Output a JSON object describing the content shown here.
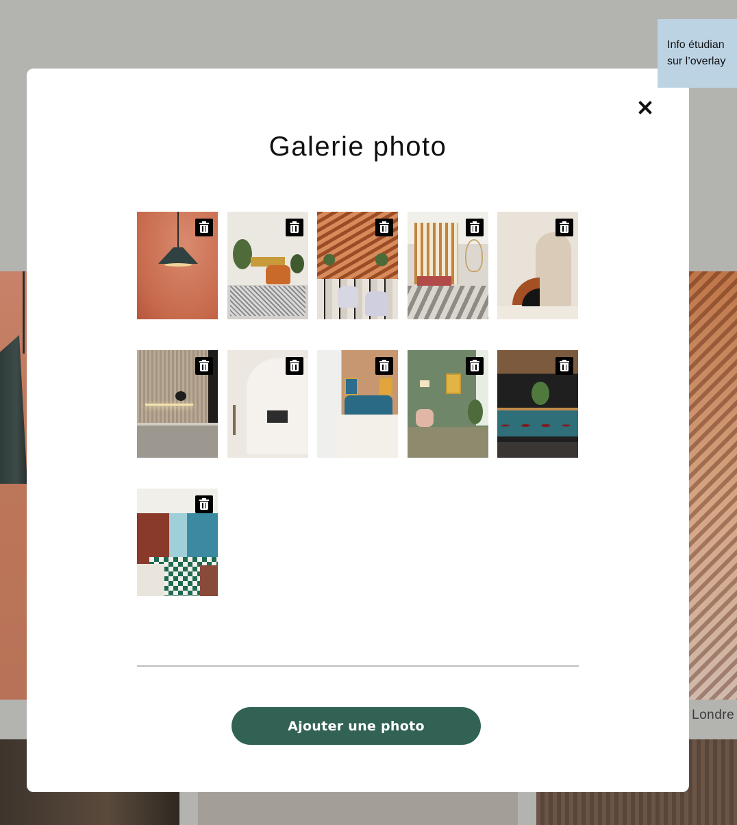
{
  "background": {
    "caption_right": "Londre"
  },
  "student_note": {
    "line1": "Info étudian",
    "line2": "sur l’overlay"
  },
  "modal": {
    "title": "Galerie photo",
    "close_icon": "close-icon",
    "add_button_label": "Ajouter une photo",
    "accent_color": "#316254",
    "photos": [
      {
        "subject": "pendant-lamp",
        "delete_icon": "trash-icon"
      },
      {
        "subject": "living-room-orange-sofa",
        "delete_icon": "trash-icon"
      },
      {
        "subject": "restaurant-wooden-roof",
        "delete_icon": "trash-icon"
      },
      {
        "subject": "patio-hanging-chair",
        "delete_icon": "trash-icon"
      },
      {
        "subject": "arches-sculpture",
        "delete_icon": "trash-icon"
      },
      {
        "subject": "kitchen-counter",
        "delete_icon": "trash-icon"
      },
      {
        "subject": "white-arch-room",
        "delete_icon": "trash-icon"
      },
      {
        "subject": "bedroom-blue-headboard",
        "delete_icon": "trash-icon"
      },
      {
        "subject": "green-lounge",
        "delete_icon": "trash-icon"
      },
      {
        "subject": "bar-red-stools",
        "delete_icon": "trash-icon"
      },
      {
        "subject": "checkered-restaurant",
        "delete_icon": "trash-icon"
      }
    ]
  }
}
